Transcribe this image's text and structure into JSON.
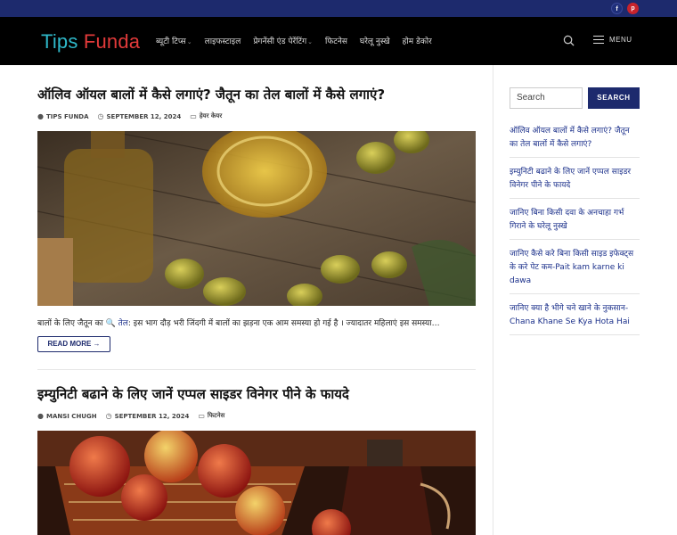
{
  "social": {
    "facebook": "f",
    "pinterest": "p"
  },
  "logo": {
    "part1": "Tips",
    "part2": "Funda"
  },
  "nav": {
    "items": [
      {
        "label": "ब्यूटी टिप्स",
        "dropdown": true
      },
      {
        "label": "लाइफस्टाइल",
        "dropdown": false
      },
      {
        "label": "प्रेगनेंसी एंड पेरेंटिंग",
        "dropdown": true
      },
      {
        "label": "फिटनेस",
        "dropdown": false
      },
      {
        "label": "घरेलू नुस्खे",
        "dropdown": false
      },
      {
        "label": "होम डेकोर",
        "dropdown": false
      }
    ],
    "menu_label": "MENU"
  },
  "posts": [
    {
      "title": "ऑलिव ऑयल बालों में कैसे लगाएं? जैतून का तेल बालों में कैसे लगाएं?",
      "author": "TIPS FUNDA",
      "date": "SEPTEMBER 12, 2024",
      "category": "हेयर केयर",
      "excerpt_pre": "बालों के लिए जैतून का ",
      "excerpt_link": "🔍 तेल",
      "excerpt_post": ": इस भाग दौड़ भरी जिंदगी में बालों का झड़ना एक आम समस्या हो गई है । ज्यादातर महिलाएं इस समस्या…",
      "read_more": "READ MORE →"
    },
    {
      "title": "इम्युनिटी बढाने के लिए जानें एप्पल साइडर विनेगर पीने के फायदे",
      "author": "MANSI CHUGH",
      "date": "SEPTEMBER 12, 2024",
      "category": "फिटनेस"
    }
  ],
  "sidebar": {
    "search_placeholder": "Search",
    "search_button": "SEARCH",
    "recent": [
      "ऑलिव ऑयल बालों में कैसे लगाएं? जैतून का तेल बालों में कैसे लगाएं?",
      "इम्युनिटी बढाने के लिए जानें एप्पल साइडर विनेगर पीने के फायदे",
      "जानिए बिना किसी दवा के अनचाहा गर्भ गिराने के घरेलू नुस्खे",
      "जानिए कैसे करे बिना किसी साइड इफेक्ट्स के करे पेट कम-Pait kam karne ki dawa",
      "जानिए क्या है भीगे चने खाने के नुकसान-Chana Khane Se Kya Hota Hai"
    ]
  },
  "colors": {
    "brand_navy": "#1d2a6d",
    "link": "#1a2f8a",
    "logo_cyan": "#2fb8c9",
    "logo_red": "#e23a3a"
  }
}
